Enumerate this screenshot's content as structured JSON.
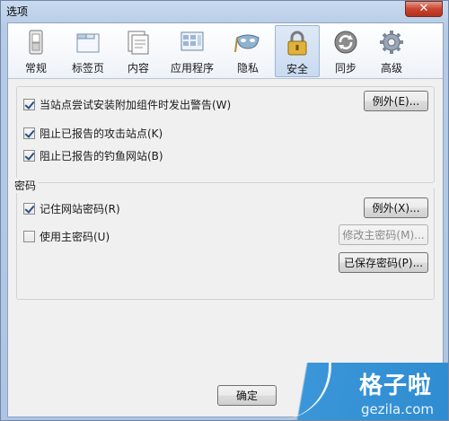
{
  "window": {
    "title": "选项",
    "close_glyph": "✕"
  },
  "tabs": [
    {
      "label": "常规",
      "icon": "switch-icon",
      "selected": false
    },
    {
      "label": "标签页",
      "icon": "tabs-icon",
      "selected": false
    },
    {
      "label": "内容",
      "icon": "page-icon",
      "selected": false
    },
    {
      "label": "应用程序",
      "icon": "applications-icon",
      "selected": false
    },
    {
      "label": "隐私",
      "icon": "mask-icon",
      "selected": false
    },
    {
      "label": "安全",
      "icon": "lock-icon",
      "selected": true
    },
    {
      "label": "同步",
      "icon": "sync-icon",
      "selected": false
    },
    {
      "label": "高级",
      "icon": "gear-icon",
      "selected": false
    }
  ],
  "security": {
    "warn_addons": {
      "label": "当站点尝试安装附加组件时发出警告(W)",
      "checked": true
    },
    "exceptions_button": "例外(E)...",
    "block_attack": {
      "label": "阻止已报告的攻击站点(K)",
      "checked": true
    },
    "block_forgery": {
      "label": "阻止已报告的钓鱼网站(B)",
      "checked": true
    }
  },
  "passwords": {
    "group_title": "密码",
    "remember": {
      "label": "记住网站密码(R)",
      "checked": true
    },
    "exceptions_button": "例外(X)...",
    "master": {
      "label": "使用主密码(U)",
      "checked": false
    },
    "change_master_button": "修改主密码(M)...",
    "saved_button": "已保存密码(P)..."
  },
  "footer": {
    "ok_button": "确定"
  },
  "watermark": {
    "cn": "格子啦",
    "en": "gezila.com"
  }
}
